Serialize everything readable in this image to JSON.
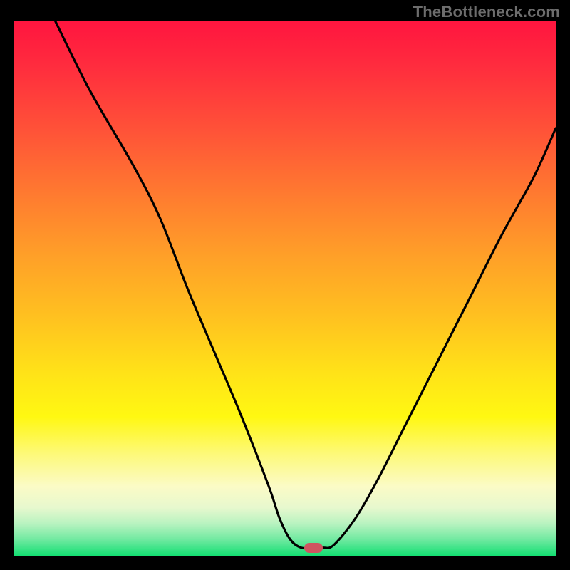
{
  "watermark": "TheBottleneck.com",
  "chart_data": {
    "type": "line",
    "title": "",
    "xlabel": "",
    "ylabel": "",
    "xlim": [
      0,
      100
    ],
    "ylim": [
      0,
      100
    ],
    "series": [
      {
        "name": "curve",
        "x": [
          7.6,
          14,
          22,
          27,
          32,
          37,
          42,
          47,
          49,
          51,
          53,
          55,
          57,
          59,
          63,
          67,
          72,
          78,
          84,
          90,
          96,
          100
        ],
        "y": [
          100,
          87,
          73,
          63,
          50,
          38,
          26,
          13,
          7,
          3,
          1.5,
          1.5,
          1.5,
          2,
          7,
          14,
          24,
          36,
          48,
          60,
          71,
          80
        ]
      }
    ],
    "marker": {
      "x": 55.3,
      "y": 1.5
    },
    "gradient_stops": [
      {
        "pos": 0,
        "color": "#ff153f"
      },
      {
        "pos": 50,
        "color": "#ffc020"
      },
      {
        "pos": 75,
        "color": "#fff812"
      },
      {
        "pos": 100,
        "color": "#14df72"
      }
    ]
  }
}
